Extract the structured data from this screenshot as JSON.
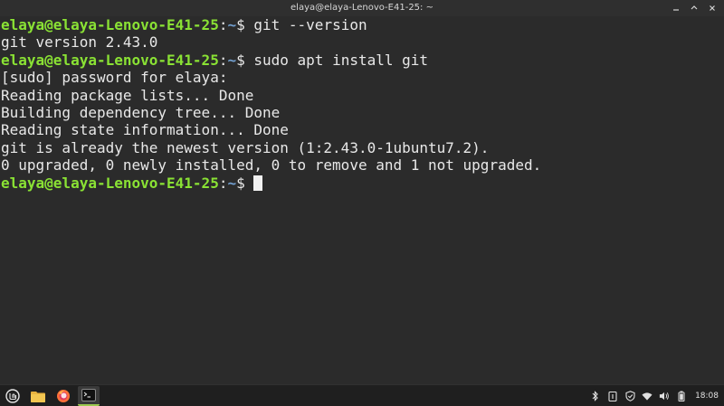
{
  "window": {
    "title": "elaya@elaya-Lenovo-E41-25: ~",
    "controls": {
      "minimize": "minimize-icon",
      "maximize": "maximize-icon",
      "close": "close-icon"
    }
  },
  "terminal": {
    "prompt_user": "elaya@elaya-Lenovo-E41-25",
    "prompt_sep": ":",
    "prompt_path": "~",
    "prompt_symbol": "$ ",
    "colors": {
      "background": "#2b2b2b",
      "text": "#e8e8e8",
      "prompt_user": "#8ae234",
      "prompt_path": "#729fcf"
    },
    "lines": [
      {
        "type": "command",
        "text": "git --version"
      },
      {
        "type": "output",
        "text": "git version 2.43.0"
      },
      {
        "type": "command",
        "text": "sudo apt install git"
      },
      {
        "type": "output",
        "text": "[sudo] password for elaya:"
      },
      {
        "type": "output",
        "text": "Reading package lists... Done"
      },
      {
        "type": "output",
        "text": "Building dependency tree... Done"
      },
      {
        "type": "output",
        "text": "Reading state information... Done"
      },
      {
        "type": "output",
        "text": "git is already the newest version (1:2.43.0-1ubuntu7.2)."
      },
      {
        "type": "output",
        "text": "0 upgraded, 0 newly installed, 0 to remove and 1 not upgraded."
      },
      {
        "type": "command",
        "text": ""
      }
    ]
  },
  "taskbar": {
    "launchers": [
      {
        "name": "menu-button",
        "icon": "linux-mint-menu-icon"
      },
      {
        "name": "files-button",
        "icon": "folder-icon"
      },
      {
        "name": "firefox-button",
        "icon": "firefox-icon"
      },
      {
        "name": "terminal-button",
        "icon": "terminal-icon",
        "active": true
      }
    ],
    "tray": [
      "bluetooth-icon",
      "clipboard-icon",
      "shield-icon",
      "wifi-icon",
      "volume-icon",
      "battery-icon"
    ],
    "clock": "18:08"
  }
}
